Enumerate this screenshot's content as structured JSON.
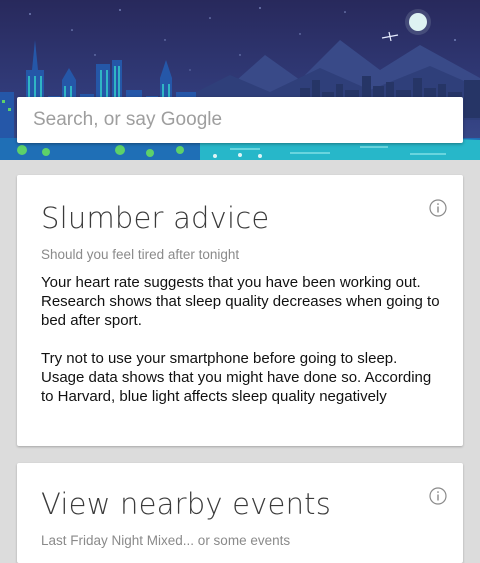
{
  "search": {
    "placeholder": "Search, or say Google"
  },
  "cards": [
    {
      "title": "Slumber advice",
      "subtitle": "Should you feel tired after tonight",
      "paragraphs": [
        "Your heart rate suggests that you have been working out. Research shows that sleep quality decreases when going to bed after sport.",
        "Try not to use your smartphone before going to sleep. Usage data shows that you might have done so. According to Harvard, blue light affects sleep quality negatively"
      ],
      "info_icon": "info-icon"
    },
    {
      "title": "View nearby events",
      "subtitle": "Last Friday Night Mixed... or some events",
      "info_icon": "info-icon"
    }
  ],
  "colors": {
    "sky_top": "#2a2e63",
    "sky_bottom": "#3c4a8a",
    "city": "#1f3b78",
    "accent_teal": "#28c4d4",
    "accent_green": "#5dd16a",
    "background": "#dcdcdc"
  }
}
